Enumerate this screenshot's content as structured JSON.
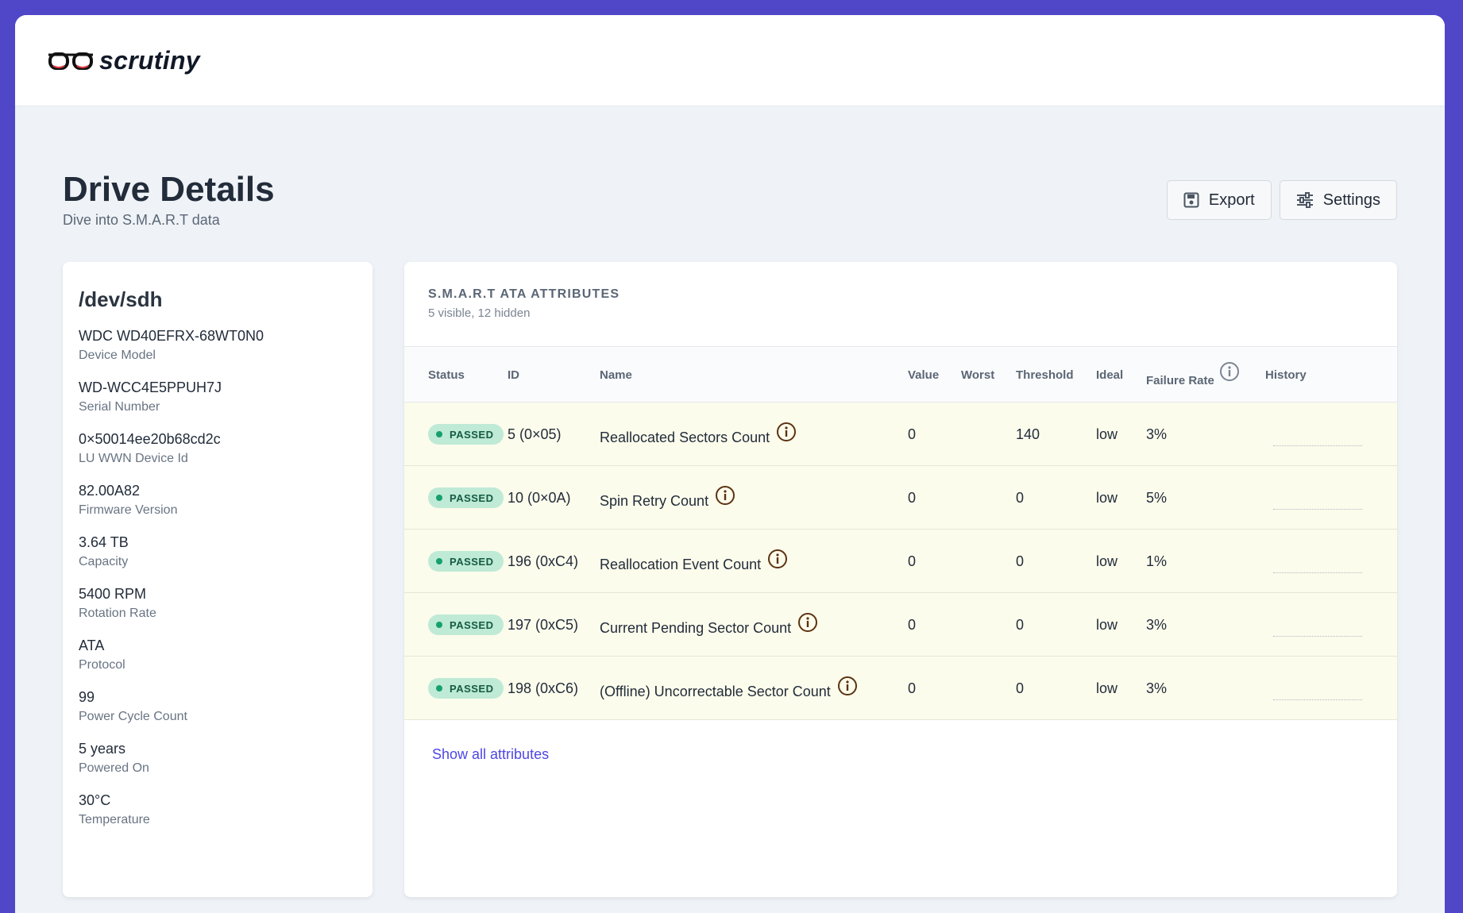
{
  "app": {
    "logo_text": "scrutiny"
  },
  "header": {
    "title": "Drive Details",
    "subtitle": "Dive into S.M.A.R.T data"
  },
  "actions": {
    "export_label": "Export",
    "settings_label": "Settings"
  },
  "device": {
    "name": "/dev/sdh",
    "fields": [
      {
        "value": "WDC WD40EFRX-68WT0N0",
        "label": "Device Model"
      },
      {
        "value": "WD-WCC4E5PPUH7J",
        "label": "Serial Number"
      },
      {
        "value": "0×50014ee20b68cd2c",
        "label": "LU WWN Device Id"
      },
      {
        "value": "82.00A82",
        "label": "Firmware Version"
      },
      {
        "value": "3.64 TB",
        "label": "Capacity"
      },
      {
        "value": "5400 RPM",
        "label": "Rotation Rate"
      },
      {
        "value": "ATA",
        "label": "Protocol"
      },
      {
        "value": "99",
        "label": "Power Cycle Count"
      },
      {
        "value": "5 years",
        "label": "Powered On"
      },
      {
        "value": "30°C",
        "label": "Temperature"
      }
    ]
  },
  "attributes": {
    "title": "S.M.A.R.T ATA ATTRIBUTES",
    "subtitle": "5 visible, 12 hidden",
    "columns": {
      "status": "Status",
      "id": "ID",
      "name": "Name",
      "value": "Value",
      "worst": "Worst",
      "threshold": "Threshold",
      "ideal": "Ideal",
      "failure_rate": "Failure Rate",
      "history": "History"
    },
    "rows": [
      {
        "status": "PASSED",
        "id": "5 (0×05)",
        "name": "Reallocated Sectors Count",
        "value": "0",
        "worst": "",
        "threshold": "140",
        "ideal": "low",
        "failure_rate": "3%"
      },
      {
        "status": "PASSED",
        "id": "10 (0×0A)",
        "name": "Spin Retry Count",
        "value": "0",
        "worst": "",
        "threshold": "0",
        "ideal": "low",
        "failure_rate": "5%"
      },
      {
        "status": "PASSED",
        "id": "196 (0xC4)",
        "name": "Reallocation Event Count",
        "value": "0",
        "worst": "",
        "threshold": "0",
        "ideal": "low",
        "failure_rate": "1%"
      },
      {
        "status": "PASSED",
        "id": "197 (0xC5)",
        "name": "Current Pending Sector Count",
        "value": "0",
        "worst": "",
        "threshold": "0",
        "ideal": "low",
        "failure_rate": "3%"
      },
      {
        "status": "PASSED",
        "id": "198 (0xC6)",
        "name": "(Offline) Uncorrectable Sector Count",
        "value": "0",
        "worst": "",
        "threshold": "0",
        "ideal": "low",
        "failure_rate": "3%"
      }
    ],
    "show_all_label": "Show all attributes"
  },
  "colors": {
    "brand": "#5046c8",
    "passed_bg": "#bfead6",
    "passed_text": "#145b43",
    "row_bg": "#fcfcec",
    "link": "#4f46e5"
  },
  "icons": {
    "logo": "glasses-icon",
    "export": "floppy-disk-icon",
    "settings": "sliders-icon",
    "info": "info-circle-icon"
  }
}
